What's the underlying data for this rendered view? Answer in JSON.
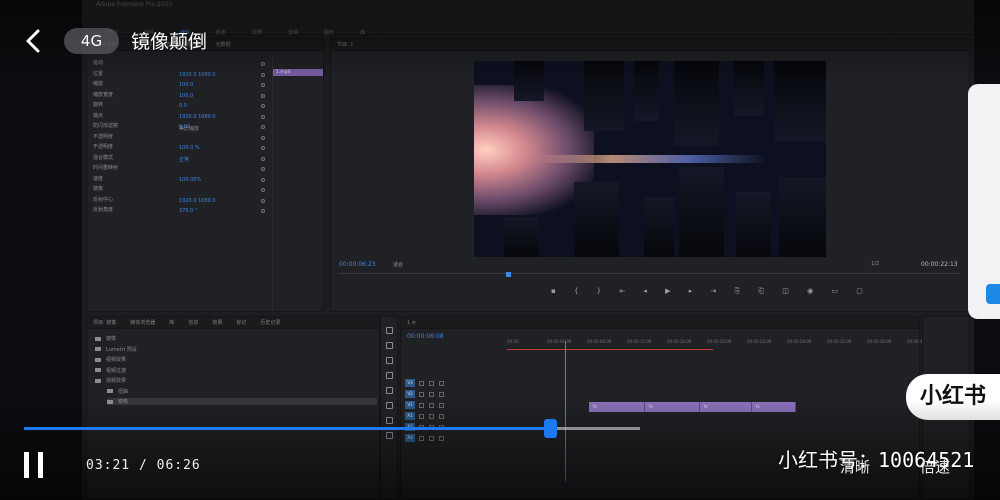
{
  "header": {
    "network": "4G",
    "title": "镜像颠倒"
  },
  "premiere": {
    "program_timecode": "00:00:06:23",
    "program_fit": "适合",
    "program_resolution": "1/2",
    "program_duration": "00:00:22:13",
    "timeline_timecode": "00:00:06:08",
    "ruler_ticks": [
      "00:00",
      "00:00:04:00",
      "00:00:08:00",
      "00:00:12:00",
      "00:00:16:00",
      "00:00:20:00",
      "00:00:24:00",
      "00:00:28:00",
      "00:00:32:00",
      "00:00:36:00",
      "00:00:40:00"
    ],
    "effect_rows": [
      "运动",
      "位置",
      "缩放",
      "缩放宽度",
      "旋转",
      "锚点",
      "防闪烁滤镜",
      "不透明度",
      "不透明度",
      "混合模式",
      "时间重映射",
      "速度",
      "镜像",
      "反射中心",
      "反射角度"
    ],
    "effect_values": [
      "1920.0   1080.0",
      "100.0",
      "100.0",
      "0.0",
      "1920.0   1080.0",
      "0.00",
      "100.0 %",
      "正常",
      "100.00%",
      "1920.0   1080.0",
      "270.0 °"
    ],
    "uniform_scale": "等比缩放",
    "project_items": [
      "镜像",
      "Lumetri 预设",
      "视频效果",
      "视频过渡",
      "视频效果",
      "扭曲",
      "镜像"
    ],
    "track_labels": [
      "V3",
      "V2",
      "V1",
      "A1",
      "A2",
      "A3"
    ],
    "clip_label": "fx"
  },
  "player": {
    "progress": 0.854,
    "current_time": "03:21",
    "separator": "/",
    "total_time": "06:26",
    "watermark": "小红书号：10064521",
    "select_label": "清晰",
    "speed_label": "倍速",
    "brand_text": "小红书"
  }
}
